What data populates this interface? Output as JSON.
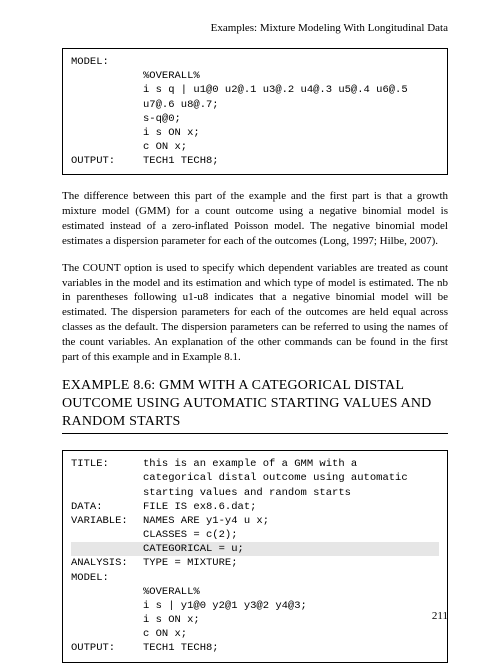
{
  "header": "Examples: Mixture Modeling With Longitudinal Data",
  "code1": {
    "model_label": "MODEL:",
    "l1": "%OVERALL%",
    "l2": "i s q | u1@0 u2@.1 u3@.2 u4@.3 u5@.4 u6@.5",
    "l3": "u7@.6 u8@.7;",
    "l4": "s-q@0;",
    "l5": "i s ON x;",
    "l6": "c ON x;",
    "output_label": "OUTPUT:",
    "l7": "TECH1 TECH8;"
  },
  "para1": "The difference between this part of the example and the first part is that a growth mixture model (GMM) for a count outcome using a negative binomial model is estimated instead of a zero-inflated Poisson model. The negative binomial model estimates a dispersion parameter for each of the outcomes (Long, 1997; Hilbe, 2007).",
  "para2": "The COUNT option is used to specify which dependent variables are treated as count variables in the model and its estimation and which type of model is estimated.  The nb in parentheses following u1-u8 indicates that a negative binomial model will be estimated.  The dispersion parameters for each of the outcomes are held equal across classes as the default.  The dispersion parameters can be referred to using the names of the count variables.  An explanation of the other commands can be found in the first part of this example and in Example 8.1.",
  "heading": "EXAMPLE 8.6: GMM WITH A CATEGORICAL DISTAL OUTCOME USING AUTOMATIC STARTING VALUES AND RANDOM STARTS",
  "code2": {
    "title_label": "TITLE:",
    "t1": "this is an example of a GMM with a",
    "t2": "categorical distal outcome using automatic",
    "t3": "starting values and random starts",
    "data_label": "DATA:",
    "d1": "FILE IS ex8.6.dat;",
    "variable_label": "VARIABLE:",
    "v1": "NAMES ARE y1-y4 u x;",
    "v2": "CLASSES = c(2);",
    "v3": "CATEGORICAL = u;",
    "analysis_label": "ANALYSIS:",
    "a1": "TYPE = MIXTURE;",
    "model_label": "MODEL:",
    "m1": "%OVERALL%",
    "m2": "i s | y1@0 y2@1 y3@2 y4@3;",
    "m3": "i s ON x;",
    "m4": "c ON x;",
    "output_label": "OUTPUT:",
    "o1": "TECH1 TECH8;"
  },
  "page_number": "211"
}
